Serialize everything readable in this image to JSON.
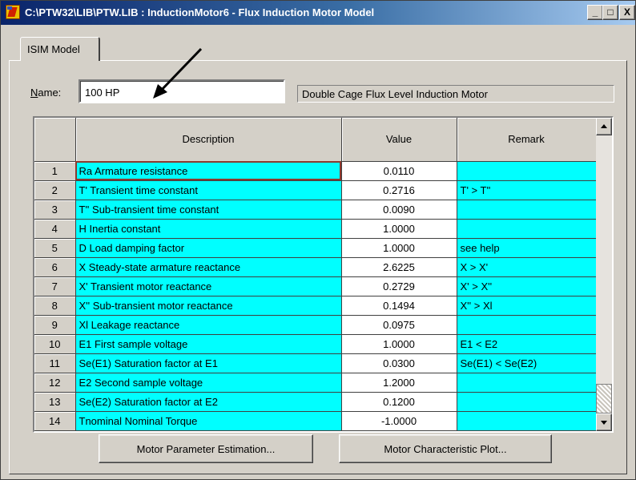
{
  "window": {
    "title": "C:\\PTW32\\LIB\\PTW.LIB : InductionMotor6 - Flux Induction Motor Model",
    "controls": [
      "_",
      "□",
      "X"
    ]
  },
  "tab": {
    "label": "ISIM Model"
  },
  "name_field": {
    "label": "Name:",
    "value": "100 HP"
  },
  "model_description": "Double Cage Flux Level Induction Motor",
  "table": {
    "columns": [
      "",
      "Description",
      "Value",
      "Remark"
    ],
    "rows": [
      {
        "num": "1",
        "description": "Ra Armature resistance",
        "value": "0.0110",
        "remark": ""
      },
      {
        "num": "2",
        "description": "T' Transient time constant",
        "value": "0.2716",
        "remark": "T' > T''"
      },
      {
        "num": "3",
        "description": "T'' Sub-transient time constant",
        "value": "0.0090",
        "remark": ""
      },
      {
        "num": "4",
        "description": "H  Inertia constant",
        "value": "1.0000",
        "remark": ""
      },
      {
        "num": "5",
        "description": "D  Load damping factor",
        "value": "1.0000",
        "remark": "see help"
      },
      {
        "num": "6",
        "description": "X  Steady-state armature reactance",
        "value": "2.6225",
        "remark": "X > X'"
      },
      {
        "num": "7",
        "description": "X' Transient motor reactance",
        "value": "0.2729",
        "remark": "X' > X''"
      },
      {
        "num": "8",
        "description": "X'' Sub-transient motor reactance",
        "value": "0.1494",
        "remark": "X'' > Xl"
      },
      {
        "num": "9",
        "description": "Xl Leakage reactance",
        "value": "0.0975",
        "remark": ""
      },
      {
        "num": "10",
        "description": "E1 First sample voltage",
        "value": "1.0000",
        "remark": "E1 < E2"
      },
      {
        "num": "11",
        "description": "Se(E1) Saturation factor at E1",
        "value": "0.0300",
        "remark": "Se(E1) < Se(E2)"
      },
      {
        "num": "12",
        "description": "E2 Second sample voltage",
        "value": "1.2000",
        "remark": ""
      },
      {
        "num": "13",
        "description": "Se(E2) Saturation factor at E2",
        "value": "0.1200",
        "remark": ""
      },
      {
        "num": "14",
        "description": "Tnominal  Nominal Torque",
        "value": "-1.0000",
        "remark": ""
      }
    ]
  },
  "buttons": {
    "estimation": "Motor Parameter Estimation...",
    "plot": "Motor Characteristic Plot..."
  },
  "colors": {
    "cell_highlight": "#00ffff",
    "title_bar": "#0a246a",
    "dialog": "#d4d0c8"
  }
}
